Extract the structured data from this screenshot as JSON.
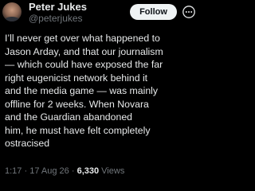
{
  "author": {
    "display_name": "Peter Jukes",
    "handle": "@peterjukes"
  },
  "follow_button": {
    "label": "Follow"
  },
  "more_button": {
    "icon": "more-icon"
  },
  "tweet": {
    "text_lines": [
      "I’ll never get over what happened to",
      "Jason Arday, and that our journalism",
      "— which could have exposed the far",
      "right eugenicist network behind it",
      "and the media game — was mainly",
      "offline for 2 weeks. When Novara",
      "and the Guardian abandoned",
      "him, he must have felt completely",
      "ostracised"
    ]
  },
  "meta": {
    "time": "1:17",
    "separator_1": "·",
    "date": "17 Aug 26",
    "separator_2": "·",
    "views_count": "6,330",
    "views_label": "Views"
  },
  "colors": {
    "background": "#000000",
    "primary_text": "#e7e9ea",
    "secondary_text": "#71767b",
    "follow_button_bg": "#eff3f4",
    "follow_button_text": "#0f1419"
  }
}
